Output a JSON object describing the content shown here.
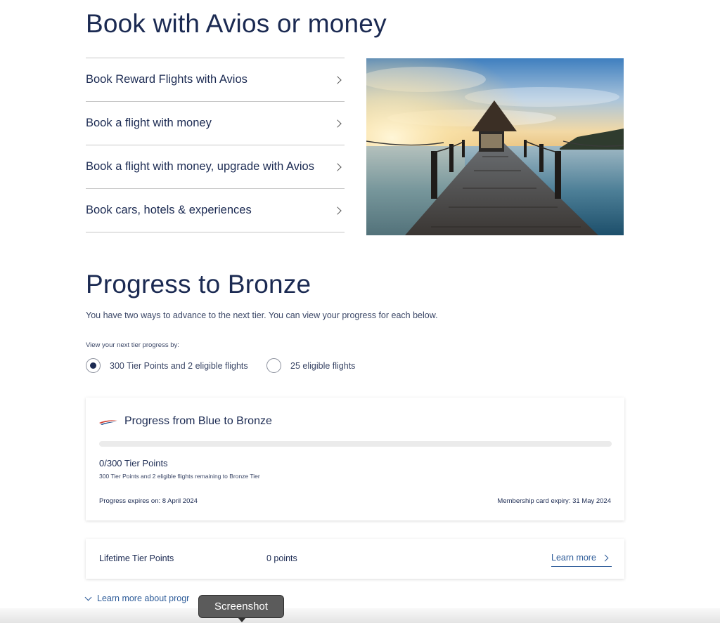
{
  "book_section": {
    "title": "Book with Avios or money",
    "items": [
      {
        "label": "Book Reward Flights with Avios"
      },
      {
        "label": "Book a flight with money"
      },
      {
        "label": "Book a flight with money, upgrade with Avios"
      },
      {
        "label": "Book cars, hotels & experiences"
      }
    ]
  },
  "progress_section": {
    "title": "Progress to Bronze",
    "intro": "You have two ways to advance to the next tier. You can view your progress for each below.",
    "view_by_label": "View your next tier progress by:",
    "options": [
      {
        "label": "300 Tier Points and 2 eligible flights",
        "selected": true
      },
      {
        "label": "25 eligible flights",
        "selected": false
      }
    ]
  },
  "progress_card": {
    "title": "Progress from Blue to Bronze",
    "progress_fraction": 0,
    "points_text": "0/300 Tier Points",
    "remaining_text": "300 Tier Points and 2 eligible flights remaining to Bronze Tier",
    "progress_expiry": "Progress expires on: 8 April 2024",
    "card_expiry": "Membership card expiry: 31 May 2024"
  },
  "lifetime_card": {
    "label": "Lifetime Tier Points",
    "value": "0 points",
    "link": "Learn more"
  },
  "learn_more_about": "Learn more about progr",
  "tooltip": {
    "label": "Screenshot"
  },
  "colors": {
    "navy": "#1b2a52",
    "link_blue": "#2e5c99",
    "divider": "#c7c7c7",
    "speedmarque_red": "#d0392b",
    "speedmarque_blue": "#1b4c8c"
  }
}
